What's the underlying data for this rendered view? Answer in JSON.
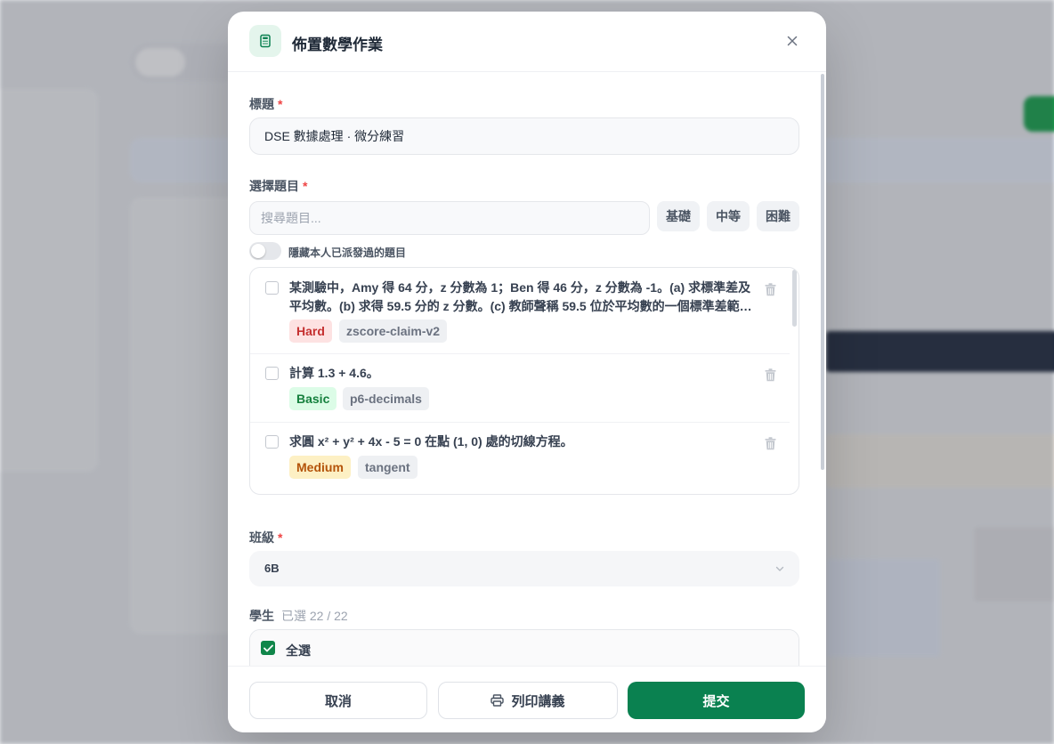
{
  "modal": {
    "title": "佈置數學作業",
    "title_field": {
      "label": "標題",
      "required_mark": "*",
      "value": "DSE 數據處理 · 微分練習"
    },
    "question_field": {
      "label": "選擇題目",
      "required_mark": "*",
      "search_placeholder": "搜尋題目...",
      "difficulty_filters": [
        "基礎",
        "中等",
        "困難"
      ],
      "hide_assigned_label": "隱藏本人已派發過的題目",
      "questions": [
        {
          "text": "某測驗中，Amy 得 64 分，z 分數為 1；Ben 得 46 分，z 分數為 -1。(a) 求標準差及平均數。(b) 求得 59.5 分的 z 分數。(c) 教師聲稱 59.5 位於平均數的一個標準差範圍內。",
          "difficulty": "Hard",
          "topic": "zscore-claim-v2"
        },
        {
          "text": "計算 1.3 + 4.6。",
          "difficulty": "Basic",
          "topic": "p6-decimals"
        },
        {
          "text": "求圓 x² + y² + 4x - 5 = 0 在點 (1, 0) 處的切線方程。",
          "difficulty": "Medium",
          "topic": "tangent"
        }
      ]
    },
    "class_field": {
      "label": "班級",
      "required_mark": "*",
      "value": "6B"
    },
    "student_field": {
      "label": "學生",
      "selected_summary": "已選 22 / 22",
      "select_all_label": "全選"
    },
    "footer": {
      "cancel_label": "取消",
      "print_label": "列印講義",
      "submit_label": "提交"
    }
  },
  "colors": {
    "primary": "#0a8150",
    "required": "#ef4444",
    "hard": "#c53030",
    "basic": "#15803d",
    "medium": "#b45309"
  },
  "icons": {
    "header": "calculator-icon",
    "close": "close-icon",
    "delete": "trash-icon",
    "print": "printer-icon",
    "dropdown": "chevron-down-icon",
    "checked": "check-icon"
  }
}
